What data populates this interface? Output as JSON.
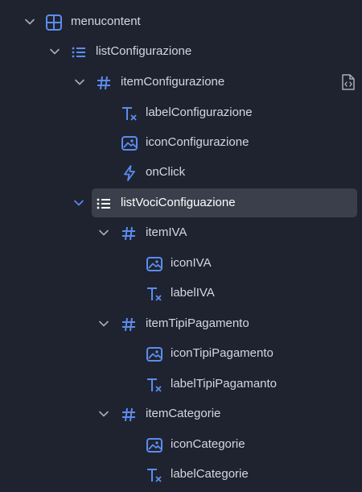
{
  "tree": {
    "nodes": [
      {
        "label": "menucontent",
        "icon": "grid-layout-icon",
        "expanded": true
      },
      {
        "label": "listConfigurazione",
        "icon": "list-icon",
        "expanded": true
      },
      {
        "label": "itemConfigurazione",
        "icon": "hash-icon",
        "expanded": true,
        "action_icon": "code-file-icon"
      },
      {
        "label": "labelConfigurazione",
        "icon": "text-clear-icon"
      },
      {
        "label": "iconConfigurazione",
        "icon": "image-icon"
      },
      {
        "label": "onClick",
        "icon": "lightning-icon"
      },
      {
        "label": "listVociConfiguazione",
        "icon": "list-icon",
        "expanded": true,
        "selected": true
      },
      {
        "label": "itemIVA",
        "icon": "hash-icon",
        "expanded": true
      },
      {
        "label": "iconIVA",
        "icon": "image-icon"
      },
      {
        "label": "labelIVA",
        "icon": "text-clear-icon"
      },
      {
        "label": "itemTipiPagamento",
        "icon": "hash-icon",
        "expanded": true
      },
      {
        "label": "iconTipiPagamento",
        "icon": "image-icon"
      },
      {
        "label": "labelTipiPagamanto",
        "icon": "text-clear-icon"
      },
      {
        "label": "itemCategorie",
        "icon": "hash-icon",
        "expanded": true
      },
      {
        "label": "iconCategorie",
        "icon": "image-icon"
      },
      {
        "label": "labelCategorie",
        "icon": "text-clear-icon"
      }
    ]
  },
  "colors": {
    "background": "#1f2330",
    "selection": "#3b3f4b",
    "text": "#d4d7e0",
    "icon_blue": "#5b8def",
    "chevron": "#a9adb8"
  }
}
